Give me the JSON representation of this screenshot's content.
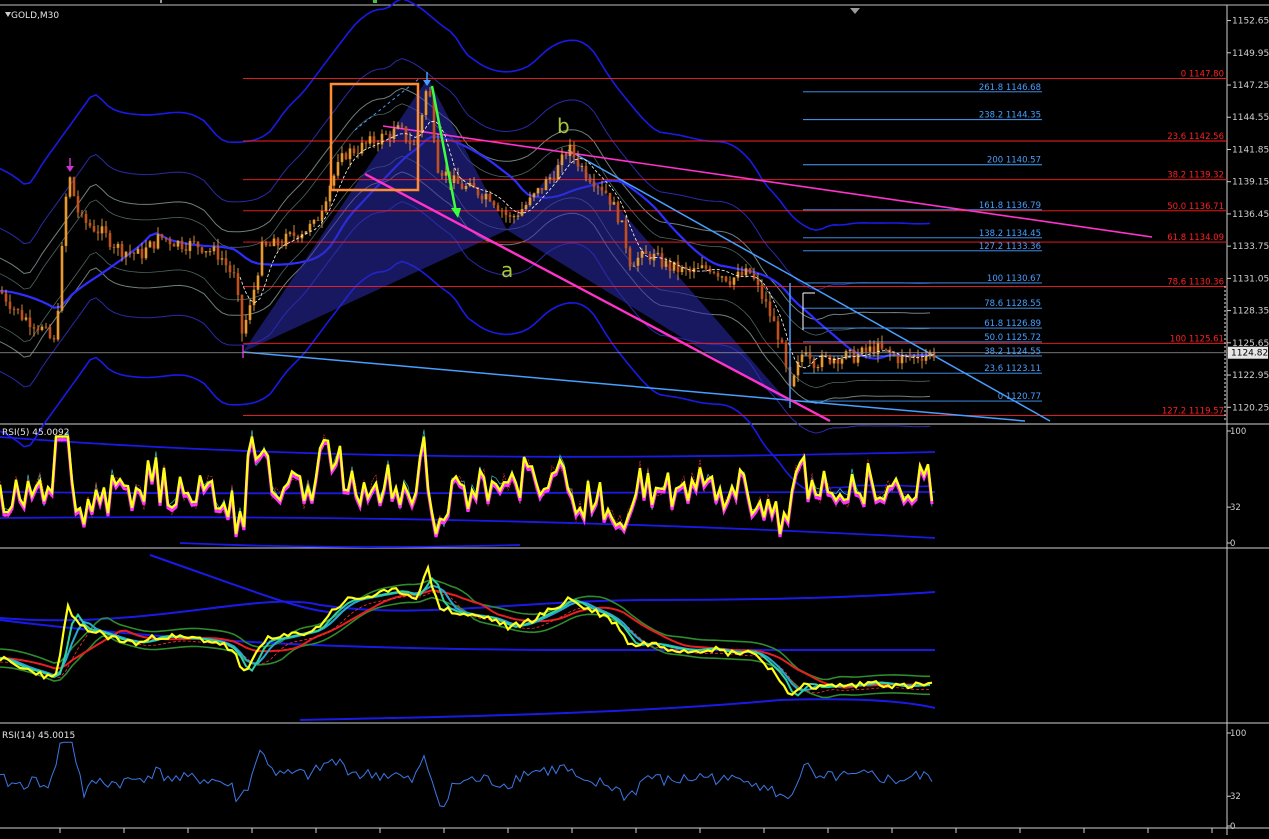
{
  "symbol": "GOLD,M30",
  "colors": {
    "background": "#000000",
    "grid": "#4d4d4d",
    "axis_text": "#cfcfcf",
    "candle_up": "#e69a2e",
    "candle_down": "#c2501a",
    "wick": "#ffb347",
    "fib_red": "#ff2020",
    "fib_blue": "#46a0ff",
    "magenta": "#ff33cc",
    "blue_band": "#1a1ae6",
    "gray_band": "#6f7f7f",
    "pattern_fill": "#2b2bb0",
    "orange_box": "#ff8c32",
    "green_arrow": "#3cff3c",
    "label_wave": "#a7c83c",
    "rsi_yellow": "#ffff1a",
    "rsi_magenta": "#ff33ff",
    "rsi14_line": "#3c78e6"
  },
  "main_axis": {
    "tick_labels": [
      "1152.65",
      "1149.95",
      "1147.25",
      "1144.55",
      "1141.85",
      "1139.15",
      "1136.45",
      "1133.75",
      "1131.05",
      "1128.35",
      "1125.65",
      "1122.95",
      "1120.25"
    ],
    "current_price": "1124.82"
  },
  "fib_red": {
    "labels": [
      "0 1147.80",
      "23.6 1142.56",
      "38.2 1139.32",
      "50.0 1136.71",
      "61.8 1134.09",
      "78.6 1130.36",
      "100 1125.61",
      "127.2 1119.57"
    ]
  },
  "fib_blue_upper": {
    "labels": [
      "261.8 1146.68",
      "238.2 1144.35",
      "200 1140.57",
      "161.8 1136.79",
      "138.2 1134.45",
      "127.2 1133.36",
      "100 1130.67"
    ]
  },
  "fib_blue_lower": {
    "labels": [
      "78.6 1128.55",
      "61.8 1126.89",
      "50.0 1125.72",
      "38.2 1124.55",
      "23.6 1123.11",
      "0 1120.77"
    ]
  },
  "wave_labels": {
    "a": "a",
    "b": "b"
  },
  "rsi5": {
    "title": "RSI(5) 45.0092",
    "ticks": [
      "100",
      "32",
      "0"
    ]
  },
  "rsi14": {
    "title": "RSI(14) 45.0015",
    "ticks": [
      "100",
      "32",
      "0"
    ]
  },
  "chart_data": {
    "type": "line",
    "title": "GOLD,M30",
    "ylim": [
      1119.1,
      1153.2
    ],
    "price_line": [
      [
        0,
        1130.0
      ],
      [
        20,
        1128.0
      ],
      [
        40,
        1127.0
      ],
      [
        55,
        1125.5
      ],
      [
        68,
        1140.0
      ],
      [
        80,
        1136.0
      ],
      [
        100,
        1135.0
      ],
      [
        120,
        1133.5
      ],
      [
        140,
        1133.0
      ],
      [
        160,
        1134.5
      ],
      [
        180,
        1134.0
      ],
      [
        200,
        1133.8
      ],
      [
        220,
        1133.0
      ],
      [
        235,
        1131.0
      ],
      [
        242,
        1126.5
      ],
      [
        250,
        1128.5
      ],
      [
        262,
        1133.5
      ],
      [
        280,
        1134.0
      ],
      [
        300,
        1135.0
      ],
      [
        315,
        1135.5
      ],
      [
        330,
        1139.0
      ],
      [
        345,
        1141.5
      ],
      [
        360,
        1142.0
      ],
      [
        380,
        1142.8
      ],
      [
        400,
        1143.5
      ],
      [
        415,
        1142.0
      ],
      [
        428,
        1147.5
      ],
      [
        438,
        1140.5
      ],
      [
        455,
        1139.0
      ],
      [
        470,
        1138.5
      ],
      [
        490,
        1138.0
      ],
      [
        510,
        1136.0
      ],
      [
        530,
        1137.5
      ],
      [
        545,
        1139.0
      ],
      [
        560,
        1140.5
      ],
      [
        568,
        1142.0
      ],
      [
        585,
        1140.0
      ],
      [
        605,
        1138.5
      ],
      [
        620,
        1136.0
      ],
      [
        630,
        1132.5
      ],
      [
        650,
        1133.0
      ],
      [
        670,
        1132.0
      ],
      [
        690,
        1131.5
      ],
      [
        710,
        1132.0
      ],
      [
        730,
        1131.0
      ],
      [
        750,
        1131.5
      ],
      [
        765,
        1129.0
      ],
      [
        780,
        1126.0
      ],
      [
        790,
        1121.5
      ],
      [
        805,
        1125.5
      ],
      [
        815,
        1124.0
      ],
      [
        835,
        1124.5
      ],
      [
        855,
        1124.5
      ],
      [
        875,
        1125.2
      ],
      [
        900,
        1124.3
      ],
      [
        935,
        1124.82
      ]
    ],
    "fib_red": [
      1147.8,
      1142.56,
      1139.32,
      1136.71,
      1134.09,
      1130.36,
      1125.61,
      1119.57
    ],
    "fib_blue": [
      1146.68,
      1144.35,
      1140.57,
      1136.79,
      1134.45,
      1133.36,
      1130.67,
      1128.55,
      1126.89,
      1125.72,
      1124.55,
      1123.11,
      1120.77
    ],
    "rsi5_last": 45.0092,
    "rsi14_last": 45.0015
  }
}
